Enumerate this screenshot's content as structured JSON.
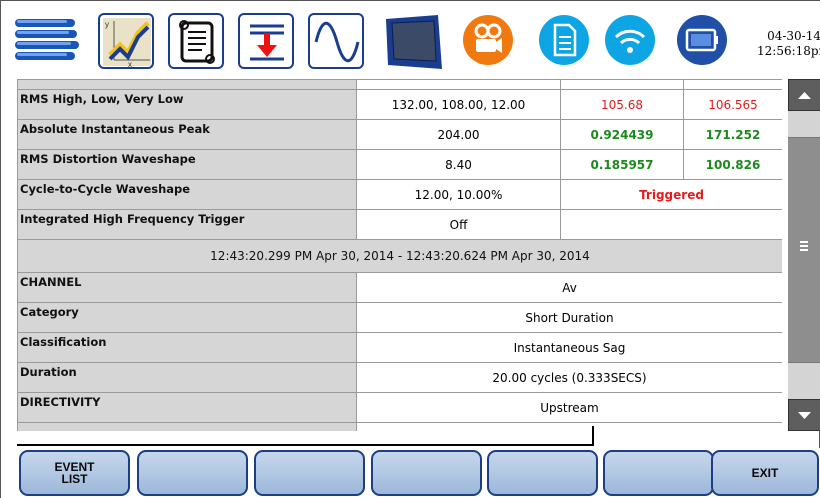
{
  "datetime": "04-30-14\n12:56:18pm",
  "icons": [
    "menu-icon",
    "chart-icon",
    "scroll-icon",
    "download-icon",
    "waveform-icon",
    "display-icon",
    "camera-icon",
    "document-icon",
    "wifi-icon",
    "battery-icon"
  ],
  "colors": {
    "blue": "#1a3d8f",
    "red": "#e21c1c",
    "green": "#1c8a1c",
    "orange": "#f07a10",
    "cyan": "#0ea5e5"
  },
  "triggers": [
    {
      "label": "RMS High, Low, Very Low",
      "setting": "132.00, 108.00, 12.00",
      "v1": "105.68",
      "v2": "106.565"
    },
    {
      "label": "Absolute Instantaneous Peak",
      "setting": "204.00",
      "v1": "0.924439",
      "v2": "171.252"
    },
    {
      "label": "RMS Distortion Waveshape",
      "setting": "8.40",
      "v1": "0.185957",
      "v2": "100.826"
    },
    {
      "label": "Cycle-to-Cycle Waveshape",
      "setting": "12.00, 10.00%",
      "status": "Triggered"
    },
    {
      "label": "Integrated High Frequency Trigger",
      "setting": "Off"
    }
  ],
  "time_range": "12:43:20.299 PM Apr 30, 2014 - 12:43:20.624 PM Apr 30, 2014",
  "details": [
    {
      "label": "CHANNEL",
      "value": "Av"
    },
    {
      "label": "Category",
      "value": "Short Duration"
    },
    {
      "label": "Classification",
      "value": "Instantaneous Sag"
    },
    {
      "label": "Duration",
      "value": "20.00 cycles (0.333SECS)"
    },
    {
      "label": "DIRECTIVITY",
      "value": "Upstream"
    }
  ],
  "fkeys": [
    "EVENT\nLIST",
    "",
    "",
    "",
    "",
    "",
    "EXIT"
  ]
}
